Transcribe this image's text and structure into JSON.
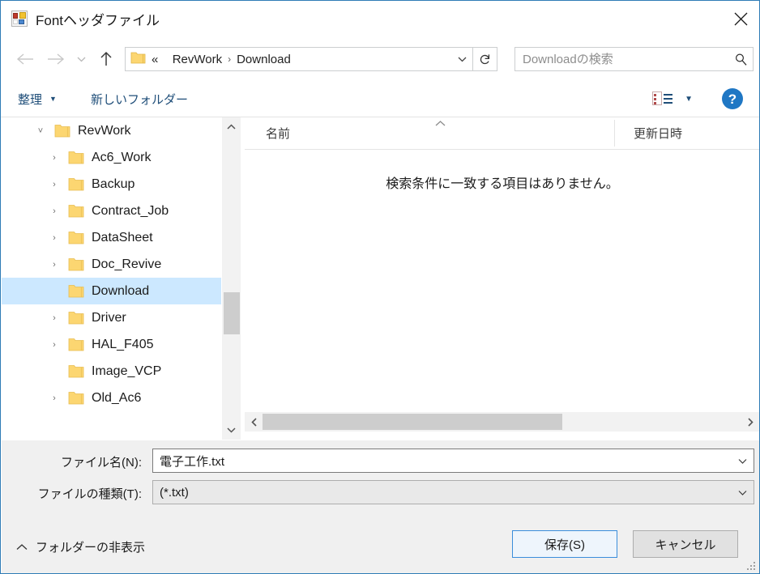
{
  "window": {
    "title": "Fontヘッダファイル",
    "app_icon": "visual-studio-icon",
    "close_label": "✕"
  },
  "nav": {
    "back_icon": "arrow-left-icon",
    "forward_icon": "arrow-right-icon",
    "recent_icon": "chevron-down-icon",
    "up_icon": "arrow-up-icon",
    "address": {
      "folder_icon": "folder-icon",
      "prefix": "«",
      "crumbs": [
        "RevWork",
        "Download"
      ],
      "separator": "›",
      "dropdown_icon": "chevron-down-icon"
    },
    "refresh_icon": "refresh-icon",
    "search": {
      "placeholder": "Downloadの検索",
      "value": "",
      "icon": "search-icon"
    }
  },
  "command_bar": {
    "organize_label": "整理",
    "organize_caret": "▼",
    "new_folder_label": "新しいフォルダー",
    "view_mode_icon": "list-view-icon",
    "view_caret": "▼",
    "help_label": "?"
  },
  "tree": {
    "items": [
      {
        "label": "RevWork",
        "indent": 0,
        "expander": "˅",
        "expandable": true,
        "selected": false
      },
      {
        "label": "Ac6_Work",
        "indent": 1,
        "expander": "›",
        "expandable": true,
        "selected": false
      },
      {
        "label": "Backup",
        "indent": 1,
        "expander": "›",
        "expandable": true,
        "selected": false
      },
      {
        "label": "Contract_Job",
        "indent": 1,
        "expander": "›",
        "expandable": true,
        "selected": false
      },
      {
        "label": "DataSheet",
        "indent": 1,
        "expander": "›",
        "expandable": true,
        "selected": false
      },
      {
        "label": "Doc_Revive",
        "indent": 1,
        "expander": "›",
        "expandable": true,
        "selected": false
      },
      {
        "label": "Download",
        "indent": 1,
        "expander": "",
        "expandable": false,
        "selected": true
      },
      {
        "label": "Driver",
        "indent": 1,
        "expander": "›",
        "expandable": true,
        "selected": false
      },
      {
        "label": "HAL_F405",
        "indent": 1,
        "expander": "›",
        "expandable": true,
        "selected": false
      },
      {
        "label": "Image_VCP",
        "indent": 1,
        "expander": "",
        "expandable": false,
        "selected": false
      },
      {
        "label": "Old_Ac6",
        "indent": 1,
        "expander": "›",
        "expandable": true,
        "selected": false
      }
    ],
    "scroll_up_icon": "chevron-up-icon",
    "scroll_down_icon": "chevron-down-icon"
  },
  "file_list": {
    "columns": [
      {
        "label": "名前",
        "sorted": true,
        "sort_caret": "⌃"
      },
      {
        "label": "更新日時",
        "sorted": false,
        "sort_caret": ""
      }
    ],
    "rows": [],
    "empty_message": "検索条件に一致する項目はありません。",
    "hscroll_left_icon": "chevron-left-icon",
    "hscroll_right_icon": "chevron-right-icon"
  },
  "form": {
    "filename_label": "ファイル名(N):",
    "filename_value": "電子工作.txt",
    "filetype_label": "ファイルの種類(T):",
    "filetype_value": "(*.txt)",
    "dropdown_icon": "chevron-down-icon"
  },
  "footer": {
    "hide_folders_caret": "∧",
    "hide_folders_label": "フォルダーの非表示",
    "save_label": "保存(S)",
    "cancel_label": "キャンセル",
    "resize_grip": "resize-grip-icon"
  },
  "colors": {
    "window_border": "#2f7cb6",
    "selection": "#cce8ff",
    "accent_link": "#1f4e79",
    "help_blue": "#1f77c4",
    "default_button_border": "#3a8ddb",
    "folder_yellow": "#fcd671"
  }
}
